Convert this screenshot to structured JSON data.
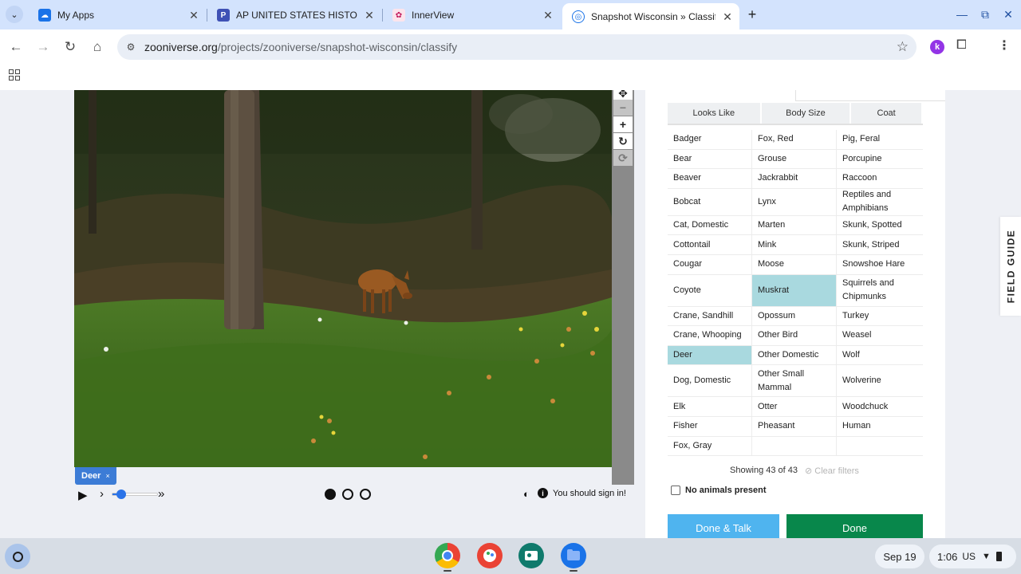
{
  "browser": {
    "tabs": [
      {
        "title": "My Apps",
        "favicon": "cloud-icon"
      },
      {
        "title": "AP UNITED STATES HISTORY A",
        "favicon": "p-logo-icon"
      },
      {
        "title": "InnerView",
        "favicon": "innerview-logo-icon"
      },
      {
        "title": "Snapshot Wisconsin » Classify",
        "favicon": "zooniverse-icon"
      }
    ],
    "url_domain": "zooniverse.org",
    "url_path": "/projects/zooniverse/snapshot-wisconsin/classify"
  },
  "subject": {
    "tag_label": "Deer",
    "tag_close": "×",
    "signin_message": "You should sign in!",
    "frames_total": 3,
    "current_frame": 1,
    "playback_progress": 0.15
  },
  "filters": {
    "tabs": [
      "Looks Like",
      "Body Size",
      "Coat"
    ]
  },
  "species": {
    "rows": [
      [
        "Badger",
        "Fox, Red",
        "Pig, Feral"
      ],
      [
        "Bear",
        "Grouse",
        "Porcupine"
      ],
      [
        "Beaver",
        "Jackrabbit",
        "Raccoon"
      ],
      [
        "Bobcat",
        "Lynx",
        "Reptiles and Amphibians"
      ],
      [
        "Cat, Domestic",
        "Marten",
        "Skunk, Spotted"
      ],
      [
        "Cottontail",
        "Mink",
        "Skunk, Striped"
      ],
      [
        "Cougar",
        "Moose",
        "Snowshoe Hare"
      ],
      [
        "Coyote",
        "Muskrat",
        "Squirrels and Chipmunks"
      ],
      [
        "Crane, Sandhill",
        "Opossum",
        "Turkey"
      ],
      [
        "Crane, Whooping",
        "Other Bird",
        "Weasel"
      ],
      [
        "Deer",
        "Other Domestic",
        "Wolf"
      ],
      [
        "Dog, Domestic",
        "Other Small Mammal",
        "Wolverine"
      ],
      [
        "Elk",
        "Otter",
        "Woodchuck"
      ],
      [
        "Fisher",
        "Pheasant",
        "Human"
      ],
      [
        "Fox, Gray",
        "",
        ""
      ]
    ],
    "selected": [
      "Deer",
      "Muskrat"
    ],
    "showing_text": "Showing 43 of 43",
    "clear_filters": "Clear filters",
    "no_animals_label": "No animals present"
  },
  "actions": {
    "done_talk": "Done & Talk",
    "done": "Done"
  },
  "field_guide": "FIELD GUIDE",
  "shelf": {
    "date": "Sep 19",
    "time": "1:06",
    "locale": "US"
  },
  "colors": {
    "selected_species": "#a9d9df",
    "done_talk": "#4fb4ef",
    "done": "#08874b",
    "subject_tag": "#3c7cd6"
  }
}
